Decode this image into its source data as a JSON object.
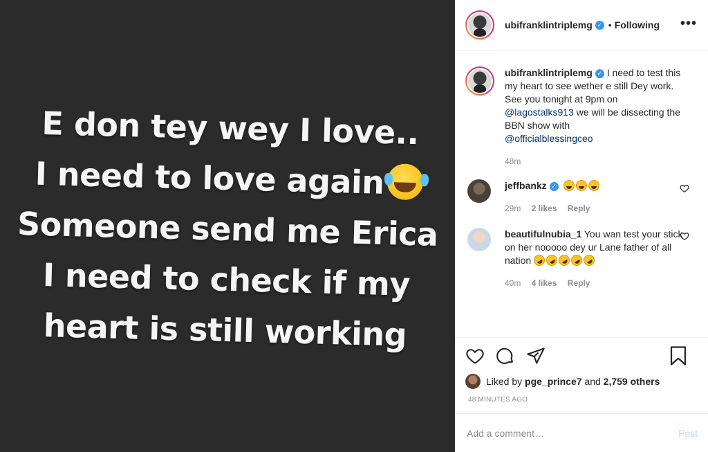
{
  "photo": {
    "lines": [
      "E don tey wey I love..",
      "I need to love again",
      "Someone send me Erica",
      "I need to check if my",
      "heart is still working"
    ],
    "emoji": "face-with-tears-of-joy"
  },
  "header": {
    "username": "ubifranklintriplemg",
    "verified": true,
    "separator": "•",
    "follow_status": "Following",
    "more": "•••"
  },
  "caption": {
    "username": "ubifranklintriplemg",
    "text_1": "I need to test this my heart to see wether e still Dey work.",
    "text_2": "See you tonight at 9pm on",
    "mention_1": "@lagostalks913",
    "text_3": "we will be dissecting the BBN show with",
    "mention_2": "@officialblessingceo",
    "time": "48m"
  },
  "comments": [
    {
      "username": "jeffbankz",
      "verified": true,
      "text": "",
      "emojis": [
        "grinning-squinting",
        "grinning-squinting",
        "grinning-squinting"
      ],
      "time": "29m",
      "likes": "2 likes",
      "reply": "Reply"
    },
    {
      "username": "beautifulnubia_1",
      "text": "You wan test your stick on her nooooo dey ur Lane father of all nation",
      "emojis": [
        "rolling-on-floor-laughing",
        "rolling-on-floor-laughing",
        "rolling-on-floor-laughing",
        "rolling-on-floor-laughing",
        "rolling-on-floor-laughing"
      ],
      "time": "40m",
      "likes": "4 likes",
      "reply": "Reply"
    }
  ],
  "actions": {
    "liked_prefix": "Liked by",
    "liked_user": "pge_prince7",
    "liked_and": "and",
    "liked_others": "2,759 others",
    "timestamp": "48 MINUTES AGO"
  },
  "add_comment": {
    "placeholder": "Add a comment…",
    "post_label": "Post"
  },
  "colors": {
    "verified": "#3897f0",
    "mention": "#00376b",
    "muted": "#8e8e8e",
    "post_disabled": "#b2dffc"
  }
}
